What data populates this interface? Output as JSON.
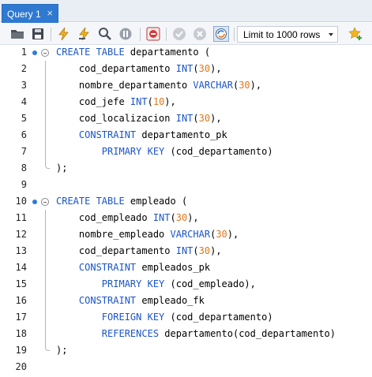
{
  "tab": {
    "label": "Query 1",
    "close": "×"
  },
  "toolbar": {
    "limit_label": "Limit to 1000 rows",
    "icons": [
      "open-folder-icon",
      "save-icon",
      "execute-icon",
      "execute-current-icon",
      "explain-icon",
      "stop-icon",
      "toggle-error-stop-icon",
      "commit-icon",
      "rollback-icon",
      "autocommit-icon",
      "add-snippet-icon"
    ]
  },
  "editor": {
    "lines": [
      {
        "n": "1",
        "parts": [
          [
            "kw",
            "CREATE TABLE"
          ],
          [
            "t",
            " departamento ("
          ]
        ]
      },
      {
        "n": "2",
        "parts": [
          [
            "t",
            "    cod_departamento "
          ],
          [
            "kw",
            "INT"
          ],
          [
            "t",
            "("
          ],
          [
            "num",
            "30"
          ],
          [
            "t",
            "),"
          ]
        ]
      },
      {
        "n": "3",
        "parts": [
          [
            "t",
            "    nombre_departamento "
          ],
          [
            "kw",
            "VARCHAR"
          ],
          [
            "t",
            "("
          ],
          [
            "num",
            "30"
          ],
          [
            "t",
            "),"
          ]
        ]
      },
      {
        "n": "4",
        "parts": [
          [
            "t",
            "    cod_jefe "
          ],
          [
            "kw",
            "INT"
          ],
          [
            "t",
            "("
          ],
          [
            "num",
            "10"
          ],
          [
            "t",
            "),"
          ]
        ]
      },
      {
        "n": "5",
        "parts": [
          [
            "t",
            "    cod_localizacion "
          ],
          [
            "kw",
            "INT"
          ],
          [
            "t",
            "("
          ],
          [
            "num",
            "30"
          ],
          [
            "t",
            "),"
          ]
        ]
      },
      {
        "n": "6",
        "parts": [
          [
            "t",
            "    "
          ],
          [
            "kw",
            "CONSTRAINT"
          ],
          [
            "t",
            " departamento_pk"
          ]
        ]
      },
      {
        "n": "7",
        "parts": [
          [
            "t",
            "        "
          ],
          [
            "kw",
            "PRIMARY KEY"
          ],
          [
            "t",
            " (cod_departamento)"
          ]
        ]
      },
      {
        "n": "8",
        "parts": [
          [
            "t",
            ");"
          ]
        ]
      },
      {
        "n": "9",
        "parts": []
      },
      {
        "n": "10",
        "parts": [
          [
            "kw",
            "CREATE TABLE"
          ],
          [
            "t",
            " empleado ("
          ]
        ]
      },
      {
        "n": "11",
        "parts": [
          [
            "t",
            "    cod_empleado "
          ],
          [
            "kw",
            "INT"
          ],
          [
            "t",
            "("
          ],
          [
            "num",
            "30"
          ],
          [
            "t",
            "),"
          ]
        ]
      },
      {
        "n": "12",
        "parts": [
          [
            "t",
            "    nombre_empleado "
          ],
          [
            "kw",
            "VARCHAR"
          ],
          [
            "t",
            "("
          ],
          [
            "num",
            "30"
          ],
          [
            "t",
            "),"
          ]
        ]
      },
      {
        "n": "13",
        "parts": [
          [
            "t",
            "    cod_departamento "
          ],
          [
            "kw",
            "INT"
          ],
          [
            "t",
            "("
          ],
          [
            "num",
            "30"
          ],
          [
            "t",
            "),"
          ]
        ]
      },
      {
        "n": "14",
        "parts": [
          [
            "t",
            "    "
          ],
          [
            "kw",
            "CONSTRAINT"
          ],
          [
            "t",
            " empleados_pk"
          ]
        ]
      },
      {
        "n": "15",
        "parts": [
          [
            "t",
            "        "
          ],
          [
            "kw",
            "PRIMARY KEY"
          ],
          [
            "t",
            " (cod_empleado),"
          ]
        ]
      },
      {
        "n": "16",
        "parts": [
          [
            "t",
            "    "
          ],
          [
            "kw",
            "CONSTRAINT"
          ],
          [
            "t",
            " empleado_fk"
          ]
        ]
      },
      {
        "n": "17",
        "parts": [
          [
            "t",
            "        "
          ],
          [
            "kw",
            "FOREIGN KEY"
          ],
          [
            "t",
            " (cod_departamento)"
          ]
        ]
      },
      {
        "n": "18",
        "parts": [
          [
            "t",
            "        "
          ],
          [
            "kw",
            "REFERENCES"
          ],
          [
            "t",
            " departamento(cod_departamento)"
          ]
        ]
      },
      {
        "n": "19",
        "parts": [
          [
            "t",
            ");"
          ]
        ]
      },
      {
        "n": "20",
        "parts": []
      }
    ]
  },
  "colors": {
    "keyword": "#1b55c9",
    "number": "#e0781a",
    "tab_active": "#2f79d0",
    "marker_dot": "#2e7bd6"
  }
}
